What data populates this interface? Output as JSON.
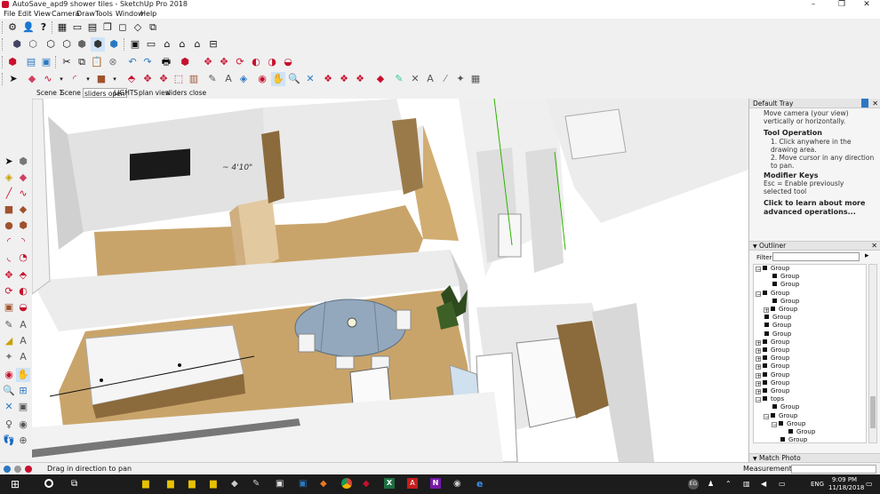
{
  "window": {
    "title": "AutoSave_apd9 shower tiles - SketchUp Pro 2018",
    "controls": [
      "–",
      "❐",
      "✕"
    ]
  },
  "menu": [
    "File",
    "Edit",
    "View",
    "Camera",
    "Draw",
    "Tools",
    "Window",
    "Help"
  ],
  "scenes": [
    "Scene 1",
    "Scene 2",
    "sliders open",
    "LIGHTS",
    "plan view",
    "sliders close"
  ],
  "model": {
    "dimension_text": "~ 4'10\""
  },
  "tray": {
    "header": "Default Tray",
    "instructor": {
      "intro": "Move camera (your view) vertically or horizontally.",
      "tool_operation_heading": "Tool Operation",
      "steps": [
        "1. Click anywhere in the drawing area.",
        "2. Move cursor in any direction to pan."
      ],
      "modifier_heading": "Modifier Keys",
      "modifier_text": "Esc = Enable previously selected tool",
      "learn_more": "Click to learn about more advanced operations..."
    },
    "outliner": {
      "title": "Outliner",
      "filter_label": "Filter:",
      "rows": [
        {
          "label": "Group",
          "indent": 0,
          "expander": "minus"
        },
        {
          "label": "Group",
          "indent": 1,
          "expander": "none"
        },
        {
          "label": "Group",
          "indent": 1,
          "expander": "none"
        },
        {
          "label": "Group",
          "indent": 0,
          "expander": "minus"
        },
        {
          "label": "Group",
          "indent": 1,
          "expander": "none"
        },
        {
          "label": "Group",
          "indent": 1,
          "expander": "plus"
        },
        {
          "label": "Group",
          "indent": 0,
          "expander": "none"
        },
        {
          "label": "Group",
          "indent": 0,
          "expander": "none"
        },
        {
          "label": "Group",
          "indent": 0,
          "expander": "none"
        },
        {
          "label": "Group",
          "indent": 0,
          "expander": "plus"
        },
        {
          "label": "Group",
          "indent": 0,
          "expander": "plus"
        },
        {
          "label": "Group",
          "indent": 0,
          "expander": "plus"
        },
        {
          "label": "Group",
          "indent": 0,
          "expander": "plus"
        },
        {
          "label": "Group",
          "indent": 0,
          "expander": "plus"
        },
        {
          "label": "Group",
          "indent": 0,
          "expander": "plus"
        },
        {
          "label": "Group",
          "indent": 0,
          "expander": "plus"
        },
        {
          "label": "tops",
          "indent": 0,
          "expander": "minus"
        },
        {
          "label": "Group",
          "indent": 1,
          "expander": "none"
        },
        {
          "label": "Group",
          "indent": 1,
          "expander": "minus"
        },
        {
          "label": "Group",
          "indent": 2,
          "expander": "minus"
        },
        {
          "label": "Group",
          "indent": 3,
          "expander": "none"
        },
        {
          "label": "Group",
          "indent": 2,
          "expander": "none"
        }
      ]
    },
    "match_photo": "Match Photo"
  },
  "status": {
    "message": "Drag in direction to pan",
    "measurements_label": "Measurements"
  },
  "taskbar": {
    "language": "ENG",
    "time": "9:09 PM",
    "date": "11/18/2018",
    "tray_badge": "EG"
  },
  "colors": {
    "accent_blue": "#2b78c2",
    "sketchup_red": "#c8102e",
    "floor_wood": "#c9a46a",
    "wall": "#ffffff",
    "wall_shadow": "#c8c8c8"
  }
}
